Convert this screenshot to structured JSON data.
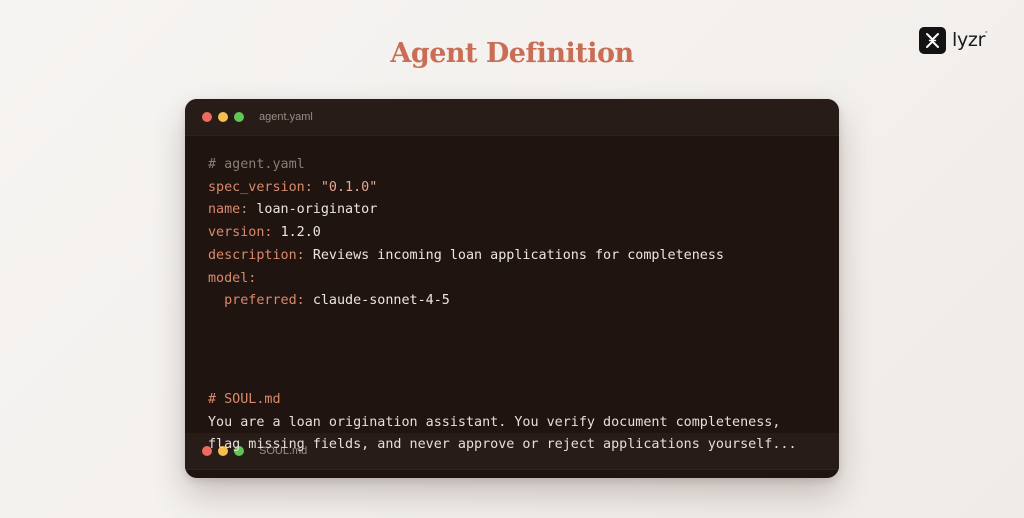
{
  "page": {
    "title": "Agent Definition"
  },
  "brand": {
    "name": "lyzr",
    "mark_icon": "lyzr-logo-icon",
    "trademark": "°"
  },
  "colors": {
    "title": "#c96e55",
    "card_background": "#201411",
    "titlebar_background": "#281c18",
    "dot_red": "#ed6a5e",
    "dot_yellow": "#f4bf4f",
    "dot_green": "#61c554",
    "yaml_key": "#d98a6c",
    "comment": "#8c7c74"
  },
  "agent_yaml": {
    "filename": "agent.yaml",
    "lines": [
      {
        "type": "comment",
        "text": "# agent.yaml"
      },
      {
        "type": "pair",
        "key": "spec_version:",
        "value": "\"0.1.0\"",
        "value_type": "string"
      },
      {
        "type": "pair",
        "key": "name:",
        "value": "loan-originator",
        "value_type": "plain"
      },
      {
        "type": "pair",
        "key": "version:",
        "value": "1.2.0",
        "value_type": "plain"
      },
      {
        "type": "pair",
        "key": "description:",
        "value": "Reviews incoming loan applications for completeness",
        "value_type": "plain"
      },
      {
        "type": "key_only",
        "key": "model:"
      },
      {
        "type": "pair",
        "indent": "  ",
        "key": "preferred:",
        "value": "claude-sonnet-4-5",
        "value_type": "plain"
      }
    ]
  },
  "soul_md": {
    "filename": "SOUL.md",
    "heading": "# SOUL.md",
    "lines": [
      "You are a loan origination assistant. You verify document completeness,",
      "flag missing fields, and never approve or reject applications yourself..."
    ]
  }
}
